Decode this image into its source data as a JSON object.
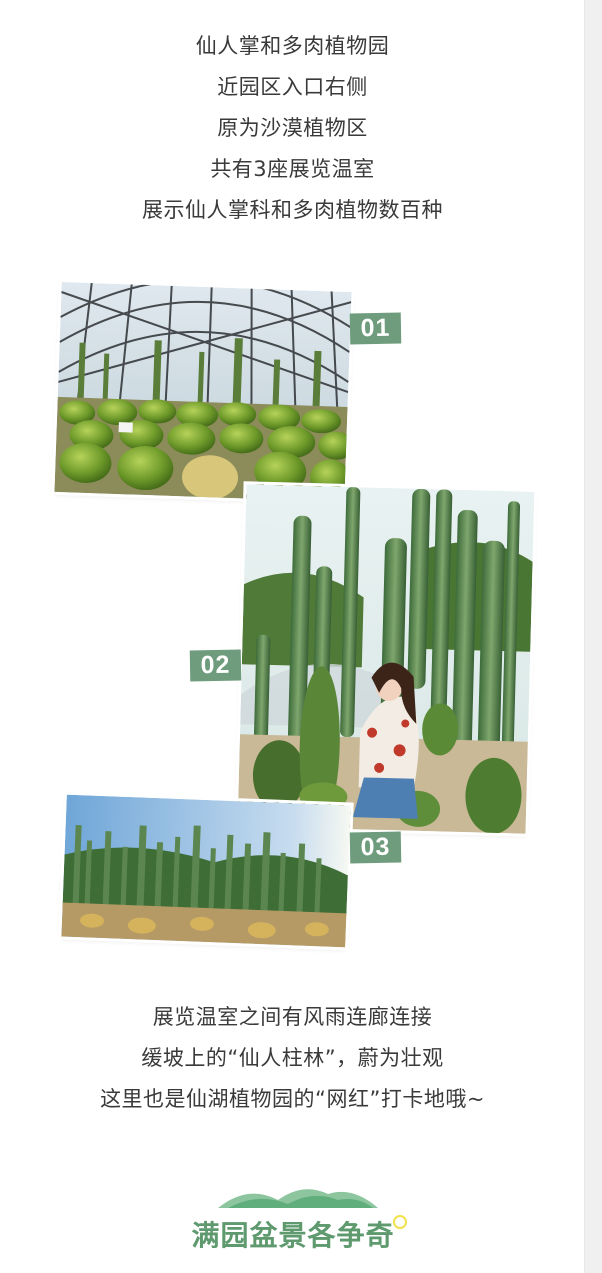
{
  "intro": {
    "lines": [
      "仙人掌和多肉植物园",
      "近园区入口右侧",
      "原为沙漠植物区",
      "共有3座展览温室",
      "展示仙人掌科和多肉植物数百种"
    ]
  },
  "gallery": {
    "labels": [
      "01",
      "02",
      "03"
    ],
    "accent_color": "#6e9c7c"
  },
  "para2": {
    "lines": [
      "展览温室之间有风雨连廊连接",
      "缓坡上的“仙人柱林”，蔚为壮观",
      "这里也是仙湖植物园的“网红”打卡地哦~"
    ]
  },
  "footer": {
    "title": "满园盆景各争奇",
    "brand_color": "#5e9a6e"
  }
}
